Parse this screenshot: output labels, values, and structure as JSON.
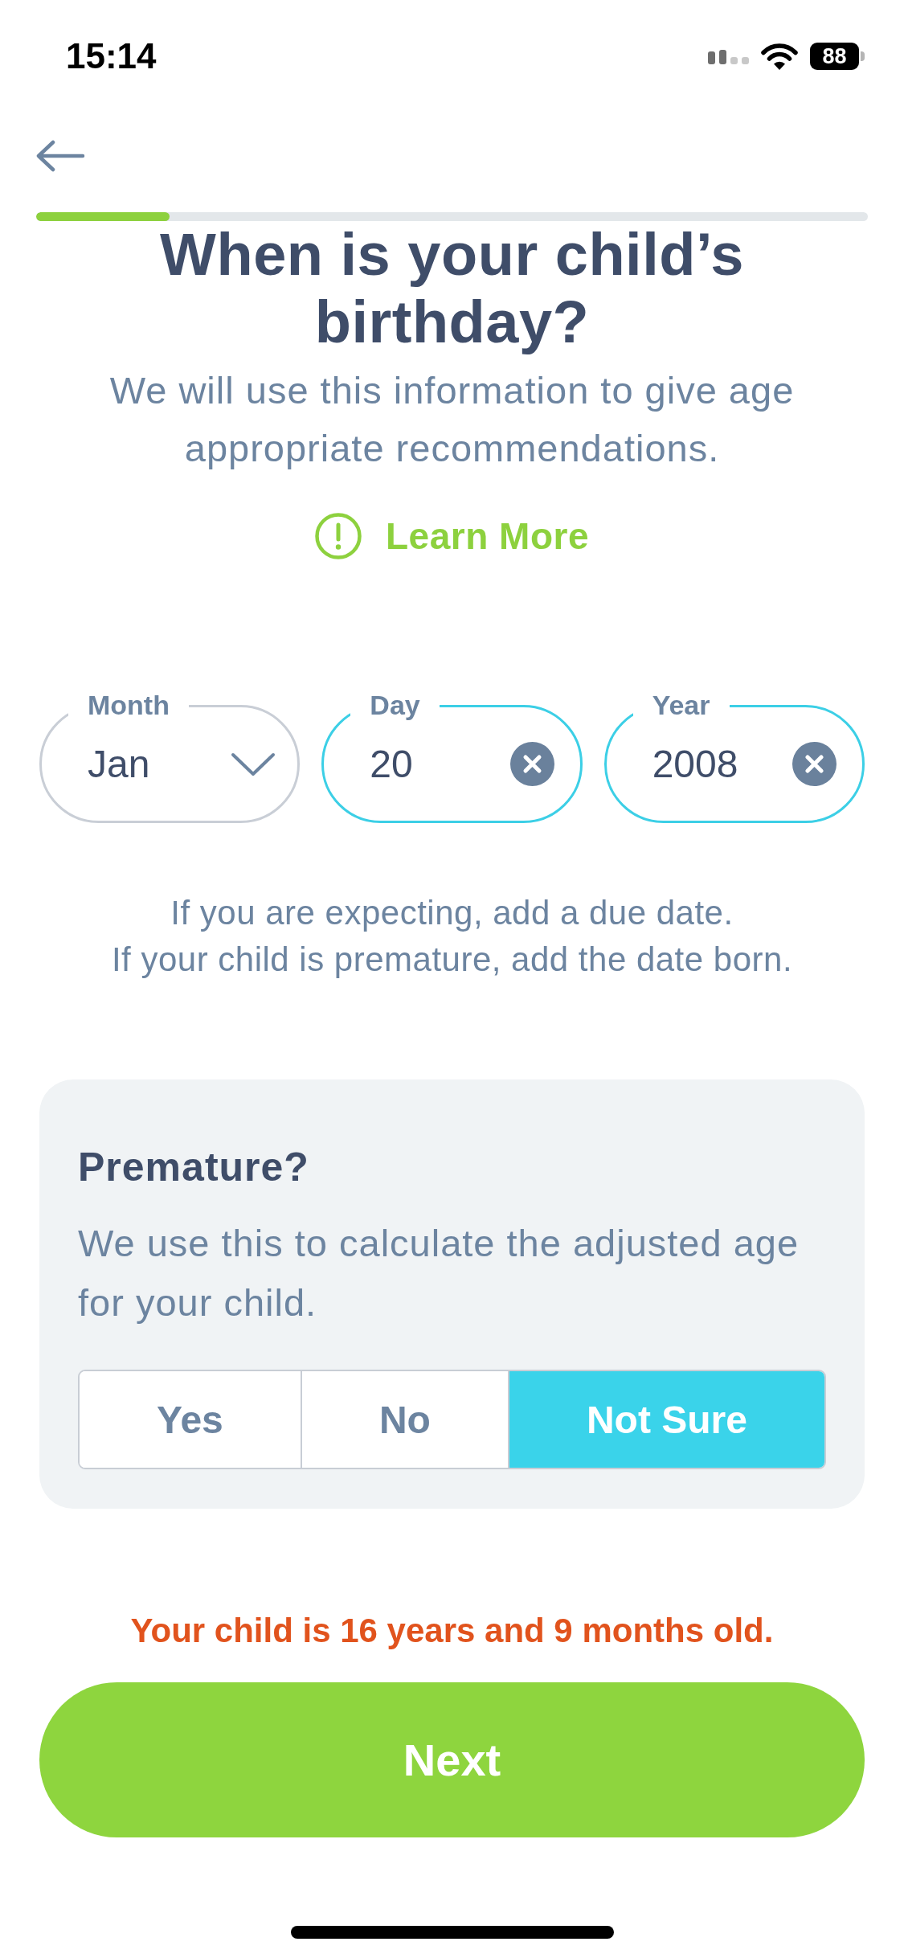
{
  "status_bar": {
    "time": "15:14",
    "battery": "88"
  },
  "progress": {
    "level": 0.16
  },
  "title": "When is your child’s birthday?",
  "subtitle": "We will use this information to give age appropriate recommendations.",
  "learn_more": {
    "label": "Learn More"
  },
  "date_fields": [
    {
      "kind": "dropdown",
      "label": "Month",
      "value": "Jan",
      "highlighted": false
    },
    {
      "kind": "clearable",
      "label": "Day",
      "value": "20",
      "highlighted": true
    },
    {
      "kind": "clearable",
      "label": "Year",
      "value": "2008",
      "highlighted": true
    }
  ],
  "hint_lines": [
    "If you are expecting, add a due date.",
    "If your child is premature, add the date born."
  ],
  "premature_card": {
    "title": "Premature?",
    "description": "We use this to calculate the adjusted age for your child.",
    "options": [
      {
        "label": "Yes",
        "selected": false
      },
      {
        "label": "No",
        "selected": false
      },
      {
        "label": "Not Sure",
        "selected": true
      }
    ]
  },
  "age_message": "Your child is 16 years and 9 months old.",
  "next_button": {
    "label": "Next"
  }
}
